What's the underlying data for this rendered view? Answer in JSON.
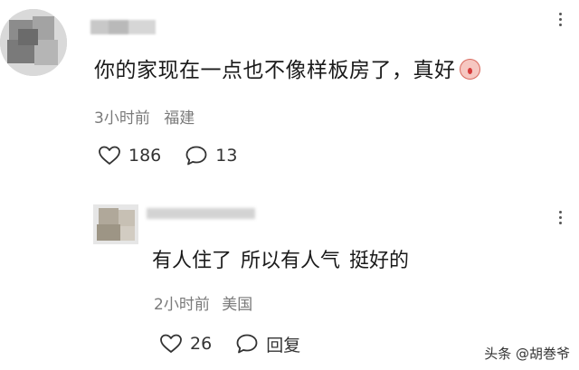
{
  "comment": {
    "text": "你的家现在一点也不像样板房了，真好",
    "time": "3小时前",
    "location": "福建",
    "likes": "186",
    "replies": "13",
    "emoji": "blushing-face-emoji"
  },
  "reply": {
    "text_part1": "有人住了",
    "text_part2": "所以有人气",
    "text_part3": "挺好的",
    "time": "2小时前",
    "location": "美国",
    "likes": "26",
    "reply_label": "回复"
  },
  "watermark": "头条 @胡巻爷",
  "colors": {
    "text": "#1a1a1a",
    "meta": "#7a7a7a",
    "background": "#ffffff"
  }
}
